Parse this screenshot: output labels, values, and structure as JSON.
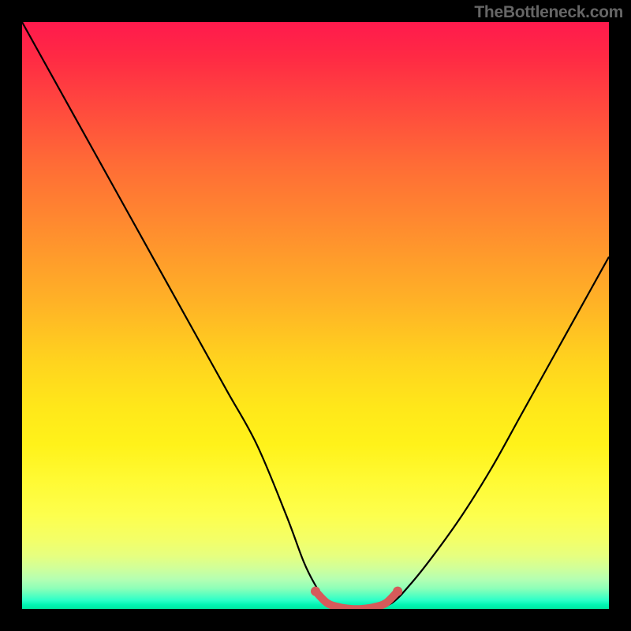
{
  "attribution": "TheBottleneck.com",
  "chart_data": {
    "type": "line",
    "title": "",
    "xlabel": "",
    "ylabel": "",
    "xlim": [
      0,
      100
    ],
    "ylim": [
      0,
      100
    ],
    "grid": false,
    "annotations": [],
    "series": [
      {
        "name": "curve",
        "x": [
          0,
          5,
          10,
          15,
          20,
          25,
          30,
          35,
          40,
          45,
          48,
          50,
          52,
          55,
          58,
          60,
          63,
          66,
          70,
          75,
          80,
          85,
          90,
          95,
          100
        ],
        "values": [
          100,
          91,
          82,
          73,
          64,
          55,
          46,
          37,
          28,
          16,
          8,
          4,
          1,
          0,
          0,
          0,
          1,
          4,
          9,
          16,
          24,
          33,
          42,
          51,
          60
        ]
      },
      {
        "name": "highlight",
        "x": [
          50,
          52,
          54,
          56,
          58,
          60,
          62,
          64
        ],
        "values": [
          3,
          1,
          0.3,
          0,
          0,
          0.3,
          1,
          3
        ]
      }
    ],
    "colors": {
      "curve": "#000000",
      "highlight": "#d65a5a",
      "gradient_top": "#ff1a4d",
      "gradient_mid": "#ffe81a",
      "gradient_bottom": "#00e6a0"
    }
  }
}
